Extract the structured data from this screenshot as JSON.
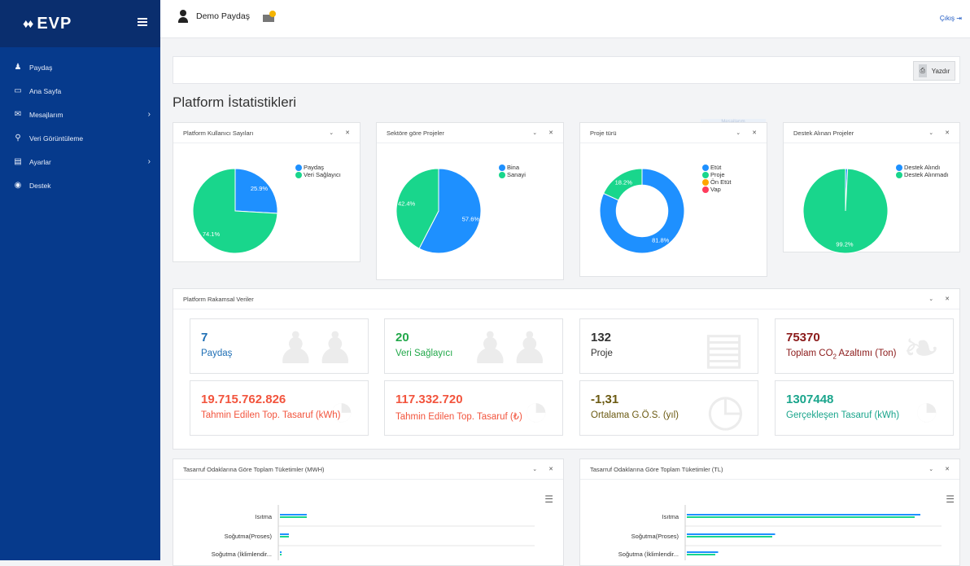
{
  "brand": {
    "name": "EVP",
    "mark": "♦♦"
  },
  "sidebar": {
    "items": [
      {
        "label": "Paydaş",
        "icon": "user-icon",
        "glyph": "♟",
        "chevron": false
      },
      {
        "label": "Ana Sayfa",
        "icon": "monitor-icon",
        "glyph": "▭",
        "chevron": false
      },
      {
        "label": "Mesajlarım",
        "icon": "envelope-icon",
        "glyph": "✉",
        "chevron": true
      },
      {
        "label": "Veri Görüntüleme",
        "icon": "search-icon",
        "glyph": "⚲",
        "chevron": false
      },
      {
        "label": "Ayarlar",
        "icon": "settings-icon",
        "glyph": "▤",
        "chevron": true
      },
      {
        "label": "Destek",
        "icon": "lifebuoy-icon",
        "glyph": "◉",
        "chevron": false
      }
    ]
  },
  "topbar": {
    "user_name": "Demo Paydaş",
    "logout_label": "Çıkış"
  },
  "toolbar": {
    "print_label": "Yazdır"
  },
  "page_title": "Platform İstatistikleri",
  "tooltip_ghost": "Mesajlarım",
  "colors": {
    "blue": "#1e90ff",
    "green": "#19d68c",
    "orange": "#ffa500",
    "red": "#ff3b5c",
    "sidebar": "#063a8c"
  },
  "pie_panels": [
    {
      "title": "Platform Kullanıcı Sayıları",
      "chart_data": {
        "type": "pie",
        "slices": [
          {
            "label": "Paydaş",
            "value": 25.9,
            "color": "#1e90ff"
          },
          {
            "label": "Veri Sağlayıcı",
            "value": 74.1,
            "color": "#19d68c"
          }
        ],
        "labels": [
          "25.9%",
          "74.1%"
        ]
      }
    },
    {
      "title": "Sektöre göre Projeler",
      "chart_data": {
        "type": "pie",
        "slices": [
          {
            "label": "Bina",
            "value": 57.6,
            "color": "#1e90ff"
          },
          {
            "label": "Sanayi",
            "value": 42.4,
            "color": "#19d68c"
          }
        ],
        "labels": [
          "57.6%",
          "42.4%"
        ]
      }
    },
    {
      "title": "Proje türü",
      "chart_data": {
        "type": "donut",
        "slices": [
          {
            "label": "Etüt",
            "value": 81.8,
            "color": "#1e90ff"
          },
          {
            "label": "Proje",
            "value": 18.2,
            "color": "#19d68c"
          },
          {
            "label": "Ön Etüt",
            "value": 0,
            "color": "#ffa500"
          },
          {
            "label": "Vap",
            "value": 0,
            "color": "#ff3b5c"
          }
        ],
        "labels": [
          "81.8%",
          "18.2%"
        ]
      }
    },
    {
      "title": "Destek Alınan Projeler",
      "chart_data": {
        "type": "pie",
        "slices": [
          {
            "label": "Destek Alındı",
            "value": 0.8,
            "color": "#1e90ff"
          },
          {
            "label": "Destek Alınmadı",
            "value": 99.2,
            "color": "#19d68c"
          }
        ],
        "labels": [
          "",
          "99.2%"
        ]
      }
    }
  ],
  "stats_panel": {
    "title": "Platform Rakamsal Veriler"
  },
  "stats": [
    {
      "value": "7",
      "label": "Paydaş",
      "color": "#1f6fb5",
      "icon": "users-icon",
      "glyph": "♟♟"
    },
    {
      "value": "20",
      "label": "Veri Sağlayıcı",
      "color": "#22a84a",
      "icon": "users-icon",
      "glyph": "♟♟"
    },
    {
      "value": "132",
      "label": "Proje",
      "color": "#333333",
      "icon": "book-icon",
      "glyph": "▤"
    },
    {
      "value": "75370",
      "label_pre": "Toplam CO",
      "label_sub": "2",
      "label_post": " Azaltımı (Ton)",
      "color": "#8b1a1a",
      "icon": "leaf-icon",
      "glyph": "❧"
    },
    {
      "value": "19.715.762.826",
      "label": "Tahmin Edilen Top. Tasaruf (kWh)",
      "color": "#f2543d",
      "icon": "gauge-icon",
      "glyph": "◔"
    },
    {
      "value": "117.332.720",
      "label": "Tahmin Edilen Top. Tasaruf (₺)",
      "color": "#f2543d",
      "icon": "gauge-icon",
      "glyph": "◔"
    },
    {
      "value": "-1,31",
      "label": "Ortalama G.Ö.S. (yıl)",
      "color": "#6b5a12",
      "icon": "clock-icon",
      "glyph": "◷"
    },
    {
      "value": "1307448",
      "label": "Gerçekleşen Tasaruf (kWh)",
      "color": "#1aa58c",
      "icon": "gauge-icon",
      "glyph": "◔"
    }
  ],
  "bar_panels": [
    {
      "title": "Tasarruf Odaklarına Göre Toplam Tüketimler (MWH)",
      "chart_data": {
        "type": "bar",
        "orientation": "horizontal",
        "categories": [
          "Isıtma",
          "Soğutma(Proses)",
          "Soğutma (İklimlendir..."
        ],
        "series": [
          {
            "color": "#1e90ff",
            "values": [
              9,
              3,
              0.5
            ]
          },
          {
            "color": "#19d68c",
            "values": [
              9,
              3,
              0.5
            ]
          }
        ],
        "xlim": [
          0,
          86
        ]
      }
    },
    {
      "title": "Tasarruf Odaklarına Göre Toplam Tüketimler (TL)",
      "chart_data": {
        "type": "bar",
        "orientation": "horizontal",
        "categories": [
          "Isıtma",
          "Soğutma(Proses)",
          "Soğutma (İklimlendir..."
        ],
        "series": [
          {
            "color": "#1e90ff",
            "values": [
              82,
              31,
              11
            ]
          },
          {
            "color": "#19d68c",
            "values": [
              80,
              30,
              10
            ]
          }
        ],
        "xlim": [
          0,
          90
        ]
      }
    }
  ]
}
